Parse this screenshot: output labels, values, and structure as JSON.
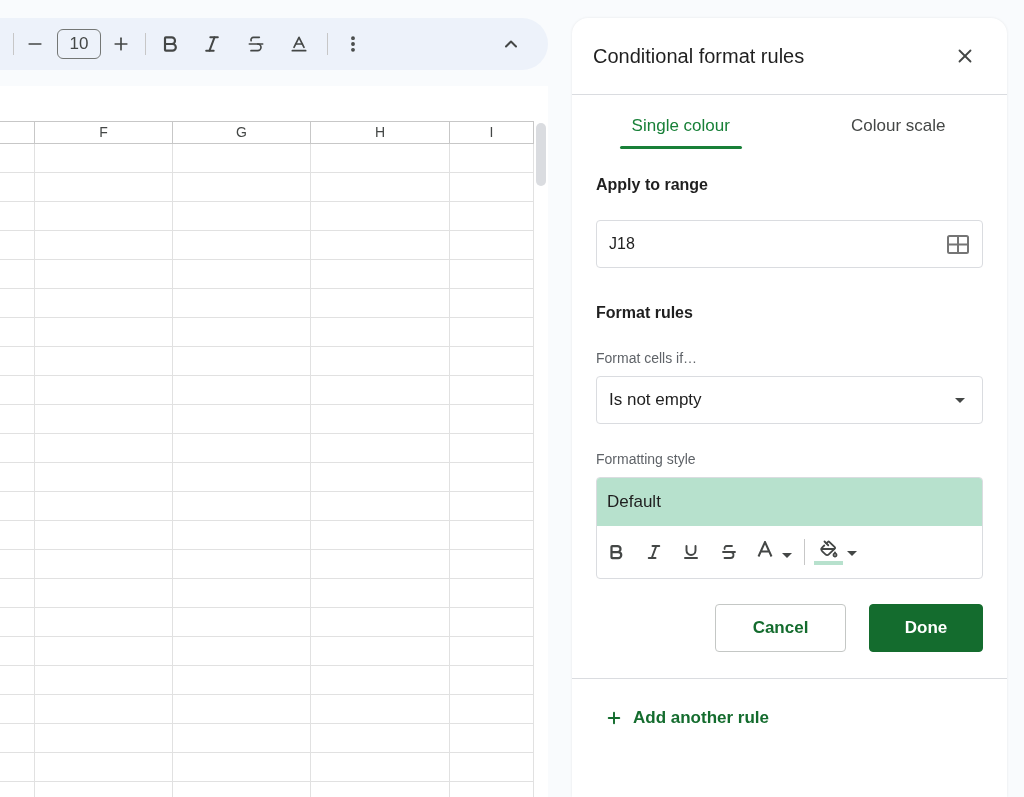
{
  "toolbar": {
    "font_size": "10"
  },
  "sheet": {
    "columns": [
      {
        "label": "F"
      },
      {
        "label": "G"
      },
      {
        "label": "H"
      },
      {
        "label": "I"
      }
    ]
  },
  "panel": {
    "title": "Conditional format rules",
    "tabs": [
      {
        "label": "Single colour",
        "selected": true
      },
      {
        "label": "Colour scale",
        "selected": false
      }
    ],
    "range": {
      "label": "Apply to range",
      "value": "J18"
    },
    "rules": {
      "heading": "Format rules",
      "condition_label": "Format cells if…",
      "condition": "Is not empty",
      "style_label": "Formatting style",
      "style_preview": "Default"
    },
    "buttons": [
      {
        "label": "Cancel",
        "kind": "secondary"
      },
      {
        "label": "Done",
        "kind": "primary"
      }
    ],
    "add_rule": "Add another rule"
  }
}
